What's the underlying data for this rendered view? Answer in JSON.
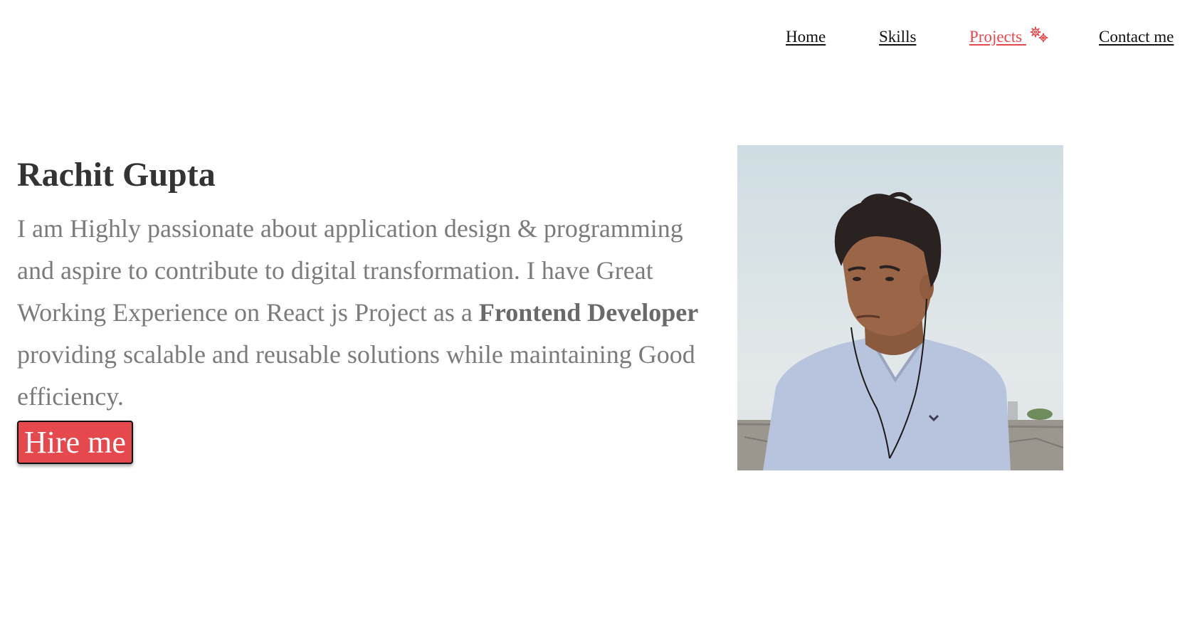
{
  "nav": {
    "items": [
      {
        "label": "Home",
        "active": false
      },
      {
        "label": "Skills",
        "active": false
      },
      {
        "label": "Projects",
        "active": true,
        "icon": "gears-icon"
      },
      {
        "label": "Contact me",
        "active": false
      }
    ]
  },
  "hero": {
    "name": "Rachit Gupta",
    "intro_text_1": "I am Highly passionate about application design & programming and aspire to contribute to digital transformation. I have Great Working Experience on React js Project as a ",
    "role": "Frontend Developer",
    "intro_text_2": " providing scalable and reusable solutions while maintaining Good efficiency.",
    "cta_label": "Hire me"
  },
  "photo": {
    "description": "profile-photo",
    "icon": "person-photo"
  },
  "colors": {
    "accent": "#e5484d",
    "heading": "#333333",
    "body_text": "#7b7b7b",
    "nav_text": "#111111"
  }
}
